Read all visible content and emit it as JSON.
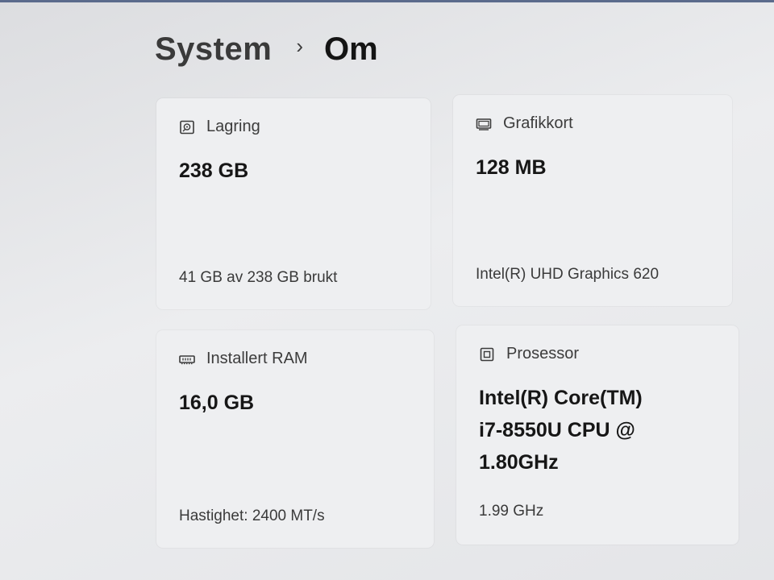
{
  "breadcrumb": {
    "parent": "System",
    "separator": "›",
    "current": "Om"
  },
  "cards": {
    "storage": {
      "icon": "storage-drive-icon",
      "label": "Lagring",
      "value": "238 GB",
      "detail": "41 GB av 238 GB brukt"
    },
    "gpu": {
      "icon": "graphics-card-icon",
      "label": "Grafikkort",
      "value": "128 MB",
      "detail": "Intel(R) UHD Graphics 620"
    },
    "ram": {
      "icon": "memory-module-icon",
      "label": "Installert RAM",
      "value": "16,0 GB",
      "detail": "Hastighet: 2400 MT/s"
    },
    "cpu": {
      "icon": "processor-chip-icon",
      "label": "Prosessor",
      "value_lines": [
        "Intel(R) Core(TM)",
        "i7-8550U CPU @",
        "1.80GHz"
      ],
      "detail": "1.99 GHz"
    }
  }
}
